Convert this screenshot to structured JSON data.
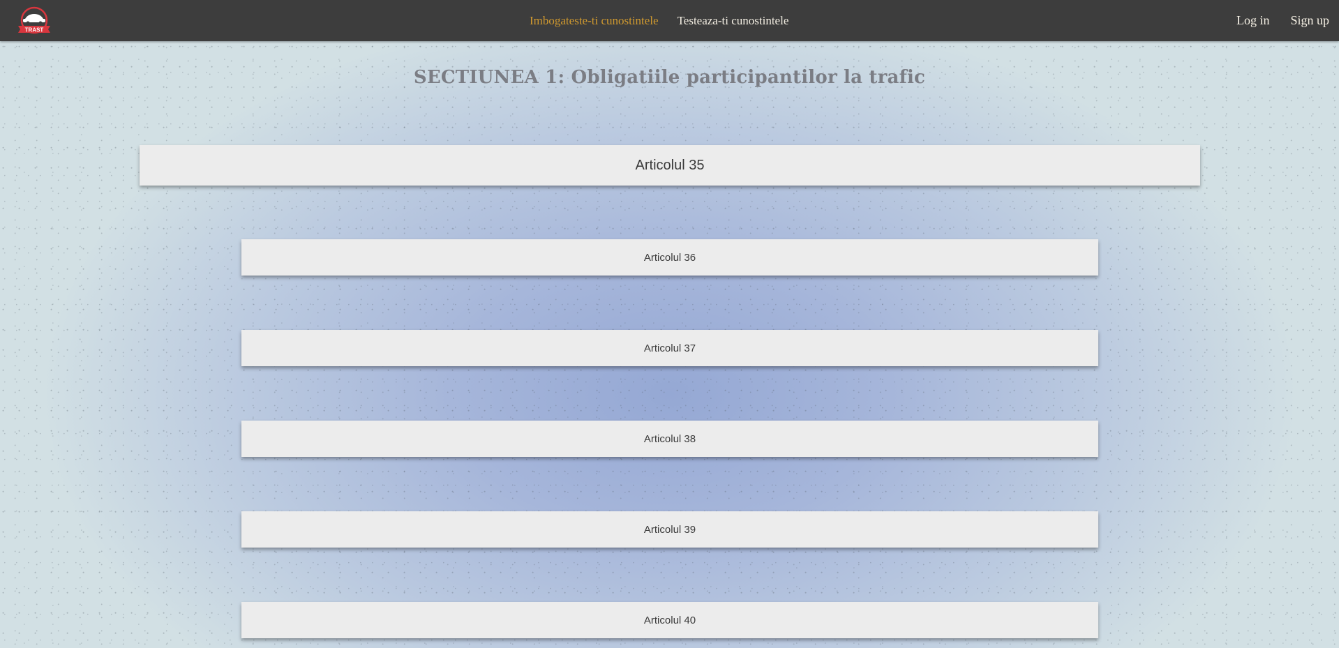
{
  "brand": {
    "logo_text": "TRAST",
    "logo_color": "#d9363e"
  },
  "nav": {
    "links": [
      {
        "label": "Imbogateste-ti cunostintele",
        "active": true
      },
      {
        "label": "Testeaza-ti cunostintele",
        "active": false
      }
    ],
    "auth": {
      "login_label": "Log in",
      "signup_label": "Sign up"
    }
  },
  "colors": {
    "navbar_bg": "#3d3d3d",
    "active_link": "#d19a2f",
    "card_bg": "#ececec",
    "title_color": "#7b7d84"
  },
  "section": {
    "title": "SECTIUNEA 1: Obligatiile participantilor la trafic"
  },
  "articles": {
    "main": "Articolul 35",
    "items": [
      "Articolul 36",
      "Articolul 37",
      "Articolul 38",
      "Articolul 39",
      "Articolul 40"
    ]
  }
}
